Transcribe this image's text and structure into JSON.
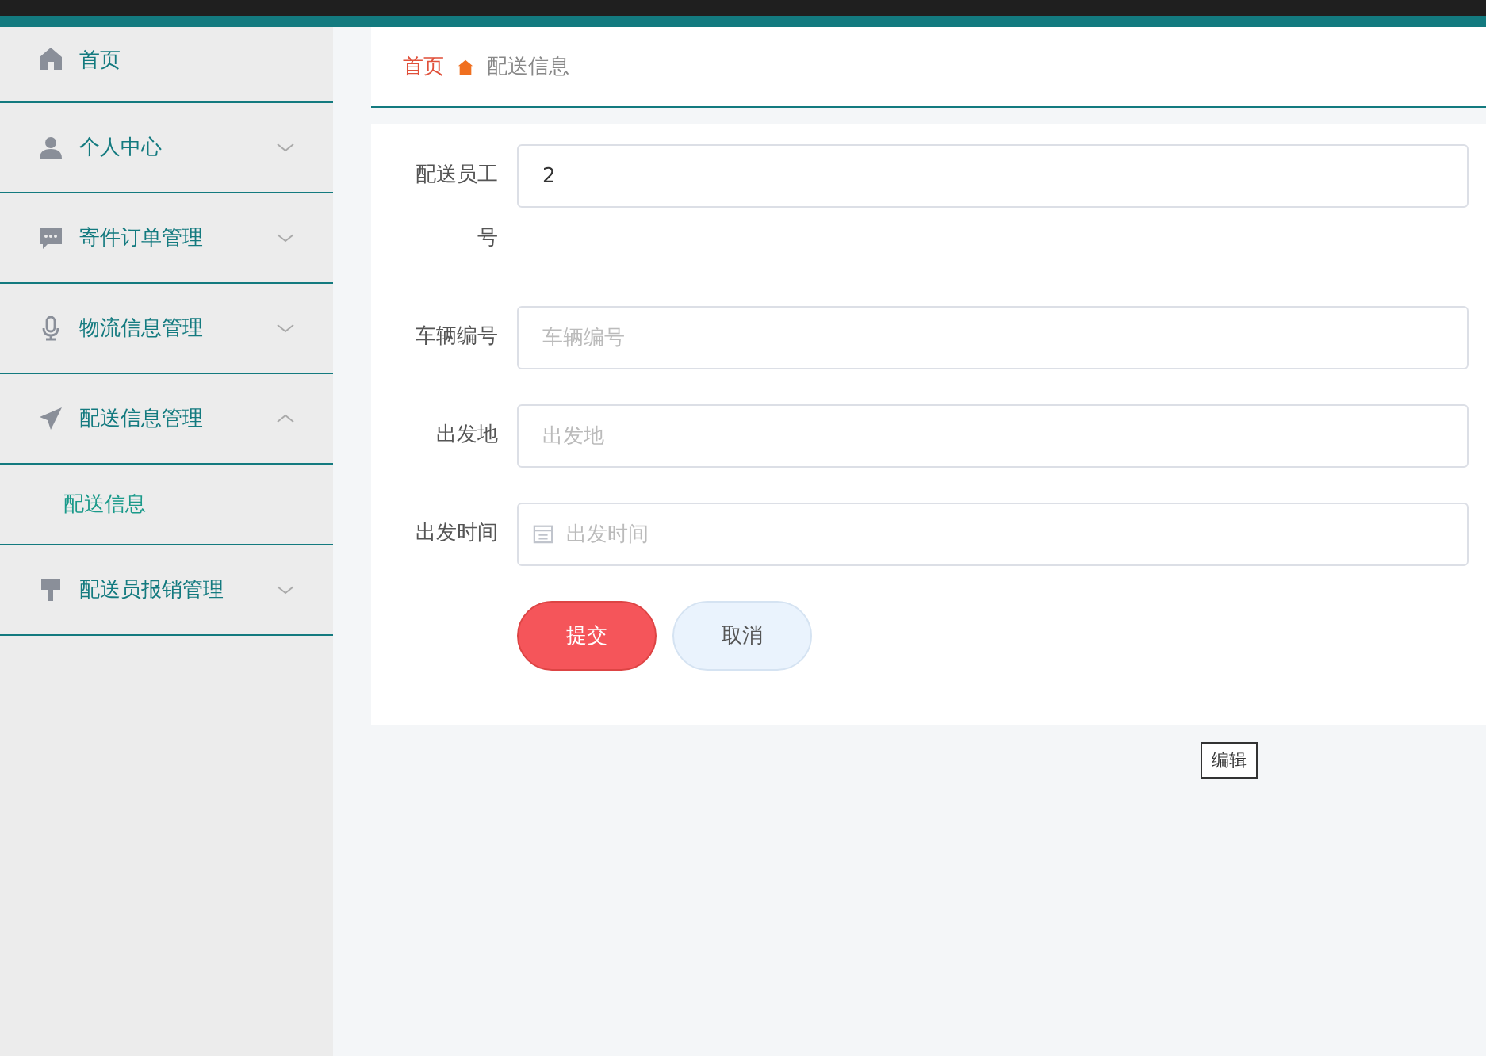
{
  "sidebar": {
    "items": [
      {
        "label": "首页",
        "kind": "link"
      },
      {
        "label": "个人中心",
        "kind": "menu",
        "expanded": false
      },
      {
        "label": "寄件订单管理",
        "kind": "menu",
        "expanded": false
      },
      {
        "label": "物流信息管理",
        "kind": "menu",
        "expanded": false
      },
      {
        "label": "配送信息管理",
        "kind": "menu",
        "expanded": true,
        "children": [
          {
            "label": "配送信息",
            "selected": true
          }
        ]
      },
      {
        "label": "配送员报销管理",
        "kind": "menu",
        "expanded": false
      }
    ]
  },
  "breadcrumb": [
    "首页",
    "配送信息"
  ],
  "form": {
    "fields": [
      {
        "label": "配送员工号",
        "kind": "text",
        "value": "2"
      },
      {
        "label": "车辆编号",
        "kind": "text",
        "placeholder": "车辆编号"
      },
      {
        "label": "出发地",
        "kind": "text",
        "placeholder": "出发地"
      },
      {
        "label": "出发时间",
        "kind": "date",
        "placeholder": "出发时间"
      }
    ],
    "buttons": [
      {
        "label": "提交",
        "kind": "primary"
      },
      {
        "label": "取消",
        "kind": "secondary"
      }
    ]
  },
  "tooltip": "编辑"
}
